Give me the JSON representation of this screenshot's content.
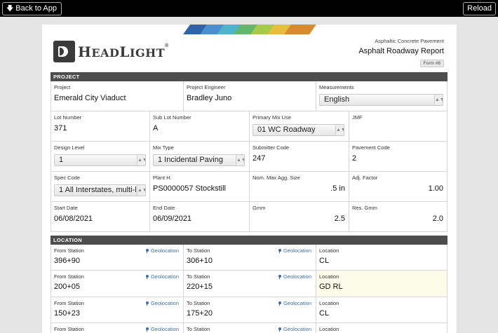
{
  "topbar": {
    "back_label": "Back to App",
    "reload_label": "Reload"
  },
  "brand": {
    "name_h": "H",
    "name_ead": "EAD",
    "name_l": "L",
    "name_ight": "IGHT",
    "reg": "®"
  },
  "stripe_colors": [
    "#2e64a8",
    "#4c8fd0",
    "#4fb3c9",
    "#62b86a",
    "#a7c94a",
    "#e8bc3c",
    "#d9892e"
  ],
  "document": {
    "subtitle": "Asphaltic Concrete Pavement",
    "title": "Asphalt Roadway Report",
    "form_badge": "Form #8"
  },
  "project": {
    "section_label": "PROJECT",
    "project": {
      "label": "Project",
      "value": "Emerald City Viaduct"
    },
    "engineer": {
      "label": "Project Engineer",
      "value": "Bradley Juno"
    },
    "measurements": {
      "label": "Measurements",
      "value": "English"
    },
    "lot_number": {
      "label": "Lot Number",
      "value": "371"
    },
    "sub_lot_number": {
      "label": "Sub Lot Number",
      "value": "A"
    },
    "primary_mix_use": {
      "label": "Primary Mix Use",
      "value": "01 WC Roadway"
    },
    "jmf": {
      "label": "JMF",
      "value": ""
    },
    "design_level": {
      "label": "Design Level",
      "value": "1"
    },
    "mix_type": {
      "label": "Mix Type",
      "value": "1 Incidental Paving"
    },
    "submitter_code": {
      "label": "Submitter Code",
      "value": "247"
    },
    "pavement_code": {
      "label": "Pavement Code",
      "value": "2"
    },
    "spec_code": {
      "label": "Spec Code",
      "value": "1 All Interstates, multi-l"
    },
    "plant": {
      "label": "Plant H.",
      "value": "PS0000057 Stockstill"
    },
    "nom_max_agg": {
      "label": "Nom. Max Agg. Size",
      "value": ".5 in"
    },
    "adj_factor": {
      "label": "Adj. Factor",
      "value": "1.00"
    },
    "start_date": {
      "label": "Start Date",
      "value": "06/08/2021"
    },
    "end_date": {
      "label": "End Date",
      "value": "06/09/2021"
    },
    "gmm": {
      "label": "Gmm",
      "value": "2.5"
    },
    "res_gmm": {
      "label": "Res. Gmm",
      "value": "2.0"
    }
  },
  "location": {
    "section_label": "LOCATION",
    "from_label": "From Station",
    "to_label": "To Station",
    "location_label": "Location",
    "geo_label": "Geolocation",
    "rows": [
      {
        "from": "396+90",
        "to": "306+10",
        "location": "CL"
      },
      {
        "from": "200+05",
        "to": "220+15",
        "location": "GD RL"
      },
      {
        "from": "150+23",
        "to": "175+20",
        "location": "CL"
      },
      {
        "from": "",
        "to": "",
        "location": ""
      }
    ]
  }
}
